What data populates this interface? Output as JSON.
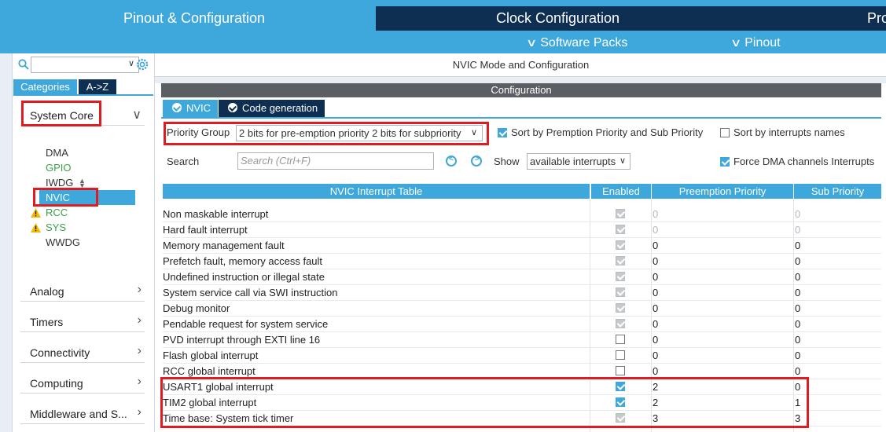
{
  "top_tabs": {
    "pinout": "Pinout & Configuration",
    "clock": "Clock Configuration",
    "project": "Project Manager"
  },
  "subbar": {
    "software_packs": "Software Packs",
    "pinout": "Pinout"
  },
  "left": {
    "search_placeholder": "",
    "tab_categories": "Categories",
    "tab_az": "A->Z",
    "system_core": "System Core",
    "items": {
      "dma": "DMA",
      "gpio": "GPIO",
      "iwdg": "IWDG",
      "nvic": "NVIC",
      "rcc": "RCC",
      "sys": "SYS",
      "wwdg": "WWDG"
    },
    "sections": {
      "analog": "Analog",
      "timers": "Timers",
      "connectivity": "Connectivity",
      "computing": "Computing",
      "middleware": "Middleware and S..."
    }
  },
  "content": {
    "title": "NVIC Mode and Configuration",
    "config_bar": "Configuration",
    "tab_nvic": "NVIC",
    "tab_code": "Code generation",
    "priority_group_label": "Priority Group",
    "priority_group_value": "2 bits for pre-emption priority 2 bits for subpriority",
    "sort_premption": "Sort by Premption Priority and Sub Priority",
    "sort_names": "Sort by interrupts names",
    "search_label": "Search",
    "search_placeholder": "Search (Ctrl+F)",
    "show_label": "Show",
    "show_value": "available interrupts",
    "force_dma": "Force DMA channels Interrupts",
    "table": {
      "headers": [
        "NVIC Interrupt Table",
        "Enabled",
        "Preemption Priority",
        "Sub Priority"
      ],
      "rows": [
        {
          "name": "Non maskable interrupt",
          "enabled": "grey",
          "pre": "0",
          "sub": "0",
          "dim": true
        },
        {
          "name": "Hard fault interrupt",
          "enabled": "grey",
          "pre": "0",
          "sub": "0",
          "dim": true
        },
        {
          "name": "Memory management fault",
          "enabled": "grey",
          "pre": "0",
          "sub": "0",
          "dim": false
        },
        {
          "name": "Prefetch fault, memory access fault",
          "enabled": "grey",
          "pre": "0",
          "sub": "0",
          "dim": false
        },
        {
          "name": "Undefined instruction or illegal state",
          "enabled": "grey",
          "pre": "0",
          "sub": "0",
          "dim": false
        },
        {
          "name": "System service call via SWI instruction",
          "enabled": "grey",
          "pre": "0",
          "sub": "0",
          "dim": false
        },
        {
          "name": "Debug monitor",
          "enabled": "grey",
          "pre": "0",
          "sub": "0",
          "dim": false
        },
        {
          "name": "Pendable request for system service",
          "enabled": "grey",
          "pre": "0",
          "sub": "0",
          "dim": false
        },
        {
          "name": "PVD interrupt through EXTI line 16",
          "enabled": "off",
          "pre": "0",
          "sub": "0",
          "dim": false
        },
        {
          "name": "Flash global interrupt",
          "enabled": "off",
          "pre": "0",
          "sub": "0",
          "dim": false
        },
        {
          "name": "RCC global interrupt",
          "enabled": "off",
          "pre": "0",
          "sub": "0",
          "dim": false
        },
        {
          "name": "USART1 global interrupt",
          "enabled": "on",
          "pre": "2",
          "sub": "0",
          "dim": false
        },
        {
          "name": "TIM2 global interrupt",
          "enabled": "on",
          "pre": "2",
          "sub": "1",
          "dim": false
        },
        {
          "name": "Time base: System tick timer",
          "enabled": "grey",
          "pre": "3",
          "sub": "3",
          "dim": false
        }
      ]
    }
  },
  "colors": {
    "accent": "#3ea7dc",
    "dark": "#0e2f52",
    "highlight": "#e11b22",
    "green": "#3aa24a"
  }
}
